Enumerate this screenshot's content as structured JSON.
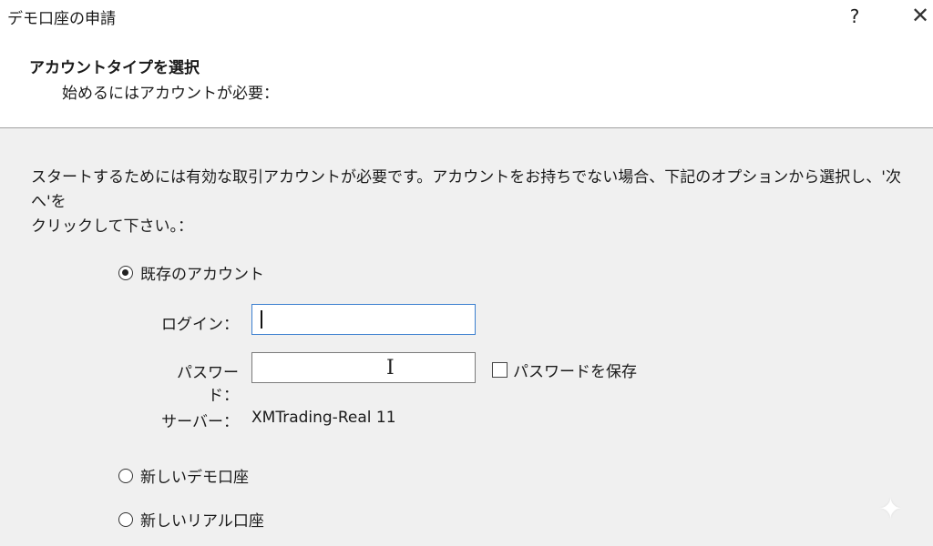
{
  "window": {
    "title": "デモ口座の申請",
    "help_label": "?",
    "close_label": "✕"
  },
  "header": {
    "title": "アカウントタイプを選択",
    "subtitle": "始めるにはアカウントが必要："
  },
  "description": {
    "line1": "スタートするためには有効な取引アカウントが必要です。アカウントをお持ちでない場合、下記のオプションから選択し、'次へ'を",
    "line2": "クリックして下さい。："
  },
  "options": {
    "existing_account": {
      "label": "既存のアカウント",
      "selected": true
    },
    "new_demo": {
      "label": "新しいデモ口座",
      "selected": false
    },
    "new_real": {
      "label": "新しいリアル口座",
      "selected": false
    }
  },
  "form": {
    "login_label": "ログイン：",
    "login_value": "",
    "password_label": "パスワード：",
    "password_value": "",
    "save_password_label": "パスワードを保存",
    "save_password_checked": false,
    "server_label": "サーバー：",
    "server_value": "XMTrading-Real 11"
  },
  "icons": {
    "sparkle": "✦",
    "text_cursor": "I"
  }
}
